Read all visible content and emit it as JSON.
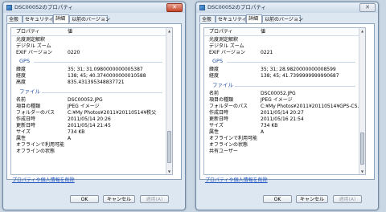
{
  "windows": [
    {
      "title": "DSC00052のプロパティ",
      "active": true,
      "tabs": [
        "全般",
        "セキュリティ",
        "詳細",
        "以前のバージョン"
      ],
      "active_tab": 2,
      "header": {
        "prop": "プロパティ",
        "value": "値"
      },
      "rows_top": [
        {
          "k": "光度測定解釈",
          "v": ""
        },
        {
          "k": "デジタル ズーム",
          "v": ""
        },
        {
          "k": "EXIF バージョン",
          "v": "0220"
        }
      ],
      "gps_label": "GPS",
      "rows_gps": [
        {
          "k": "緯度",
          "v": "35; 31; 31.0980000000005387"
        },
        {
          "k": "経度",
          "v": "138; 45; 40.3740000000010588"
        },
        {
          "k": "高度",
          "v": "835.431395348837721"
        }
      ],
      "file_label": "ファイル",
      "rows_file": [
        {
          "k": "名前",
          "v": "DSC00052.JPG"
        },
        {
          "k": "項目の種類",
          "v": "JPEG イメージ"
        },
        {
          "k": "フォルダーのパス",
          "v": "C:¥My Photos¥2011¥20110514¥秩父"
        },
        {
          "k": "作成日時",
          "v": "2011/05/14 20:26"
        },
        {
          "k": "更新日時",
          "v": "2011/05/14 21:45"
        },
        {
          "k": "サイズ",
          "v": "734 KB"
        },
        {
          "k": "属性",
          "v": "A"
        },
        {
          "k": "オフラインで利用可能",
          "v": ""
        },
        {
          "k": "オフラインの状態",
          "v": ""
        }
      ],
      "scroll_position": 0.78,
      "link": "プロパティや個人情報を削除",
      "buttons": {
        "ok": "OK",
        "cancel": "キャンセル",
        "apply": "適用(A)"
      }
    },
    {
      "title": "DSC00052のプロパティ",
      "active": false,
      "tabs": [
        "全般",
        "セキュリティ",
        "詳細",
        "以前のバージョン"
      ],
      "active_tab": 2,
      "header": {
        "prop": "プロパティ",
        "value": "値"
      },
      "rows_top": [
        {
          "k": "光度測定解釈",
          "v": ""
        },
        {
          "k": "デジタル ズーム",
          "v": ""
        },
        {
          "k": "EXIF バージョン",
          "v": "0221"
        }
      ],
      "gps_label": "GPS",
      "rows_gps": [
        {
          "k": "緯度",
          "v": "35; 31; 28.9820000000008599"
        },
        {
          "k": "経度",
          "v": "138; 45; 41.7399999999990687"
        }
      ],
      "file_label": "ファイル",
      "rows_file": [
        {
          "k": "名前",
          "v": "DSC00052.JPG"
        },
        {
          "k": "項目の種類",
          "v": "JPEG イメージ"
        },
        {
          "k": "フォルダーのパス",
          "v": "C:¥My Photos¥2011¥20110514¥GPS-CS..."
        },
        {
          "k": "作成日時",
          "v": "2011/05/14 20:27"
        },
        {
          "k": "更新日時",
          "v": "2011/05/16 21:54"
        },
        {
          "k": "サイズ",
          "v": "734 KB"
        },
        {
          "k": "属性",
          "v": "A"
        },
        {
          "k": "オフラインで利用可能",
          "v": ""
        },
        {
          "k": "オフラインの状態",
          "v": ""
        },
        {
          "k": "共有ユーザー",
          "v": ""
        }
      ],
      "scroll_position": 0.8,
      "link": "プロパティや個人情報を削除",
      "buttons": {
        "ok": "OK",
        "cancel": "キャンセル",
        "apply": "適用(A)"
      }
    }
  ]
}
